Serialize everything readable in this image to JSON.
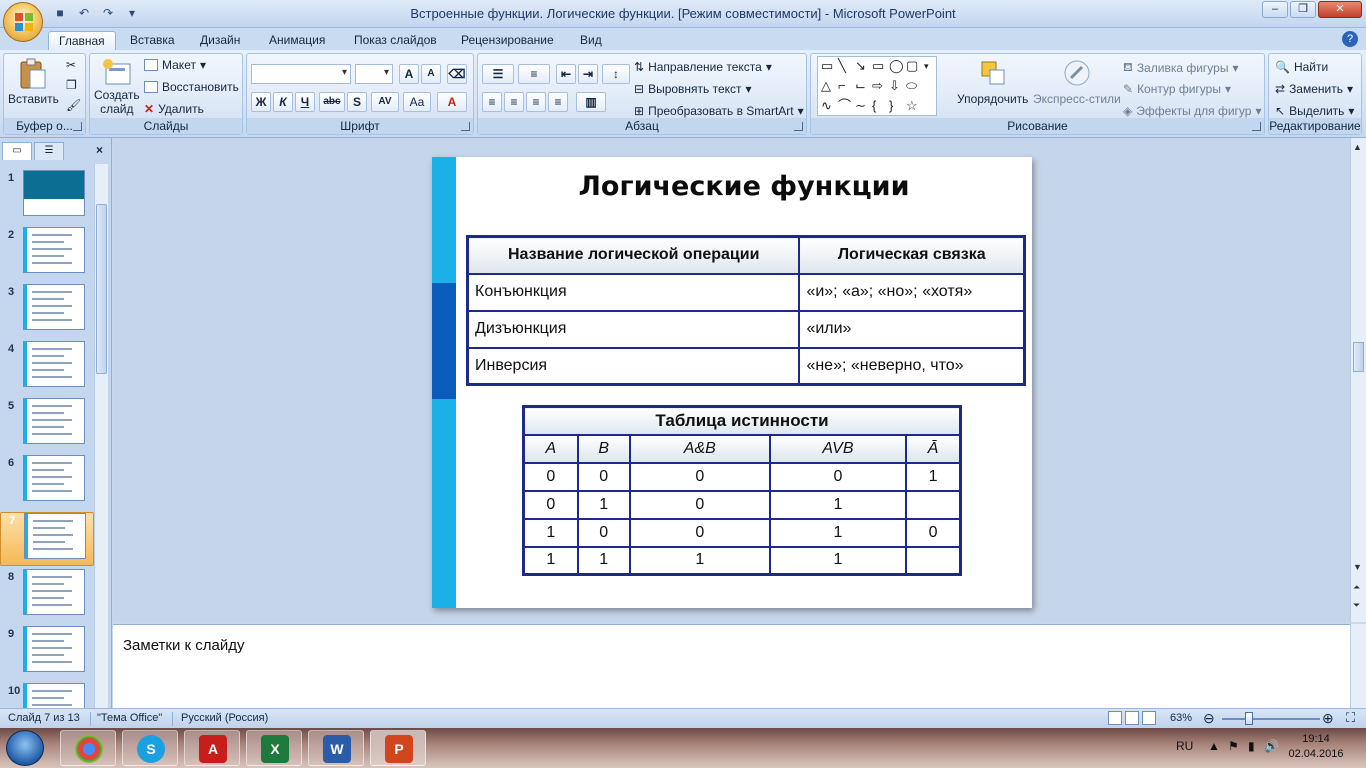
{
  "window": {
    "title": "Встроенные функции. Логические функции. [Режим совместимости] - Microsoft PowerPoint"
  },
  "ribbon_tabs": [
    "Главная",
    "Вставка",
    "Дизайн",
    "Анимация",
    "Показ слайдов",
    "Рецензирование",
    "Вид"
  ],
  "ribbon": {
    "clipboard": {
      "label": "Буфер о...",
      "paste": "Вставить"
    },
    "slides": {
      "label": "Слайды",
      "new_slide_line1": "Создать",
      "new_slide_line2": "слайд",
      "layout": "Макет",
      "reset": "Восстановить",
      "delete": "Удалить"
    },
    "font": {
      "label": "Шрифт",
      "bold": "Ж",
      "italic": "К",
      "underline": "Ч",
      "strike": "abc",
      "shadow": "S",
      "spacing": "AV",
      "case": "Aa",
      "color": "A",
      "grow": "A",
      "shrink": "A"
    },
    "paragraph": {
      "label": "Абзац",
      "text_direction": "Направление текста",
      "align_text": "Выровнять текст",
      "smartart": "Преобразовать в SmartArt"
    },
    "drawing": {
      "label": "Рисование",
      "arrange": "Упорядочить",
      "quick_styles": "Экспресс-стили",
      "fill": "Заливка фигуры",
      "outline": "Контур фигуры",
      "effects": "Эффекты для фигур"
    },
    "editing": {
      "label": "Редактирование",
      "find": "Найти",
      "replace": "Заменить",
      "select": "Выделить"
    }
  },
  "thumbnails": [
    "1",
    "2",
    "3",
    "4",
    "5",
    "6",
    "7",
    "8",
    "9",
    "10"
  ],
  "selected_slide": "7",
  "slide": {
    "title": "Логические функции",
    "ops_headers": [
      "Название логической операции",
      "Логическая связка"
    ],
    "ops_rows": [
      [
        "Конъюнкция",
        "«и»; «а»; «но»; «хотя»"
      ],
      [
        "Дизъюнкция",
        "«или»"
      ],
      [
        "Инверсия",
        "«не»; «неверно, что»"
      ]
    ],
    "truth_caption": "Таблица истинности",
    "truth_headers": [
      "A",
      "B",
      "A&B",
      "AVB",
      "Ā"
    ],
    "truth_rows": [
      [
        "0",
        "0",
        "0",
        "0",
        "1"
      ],
      [
        "0",
        "1",
        "0",
        "1",
        ""
      ],
      [
        "1",
        "0",
        "0",
        "1",
        "0"
      ],
      [
        "1",
        "1",
        "1",
        "1",
        ""
      ]
    ]
  },
  "notes": {
    "placeholder": "Заметки к слайду"
  },
  "status": {
    "slide_of": "Слайд 7 из 13",
    "theme": "\"Тема Office\"",
    "language": "Русский (Россия)",
    "zoom": "63%"
  },
  "taskbar": {
    "lang": "RU",
    "time": "19:14",
    "date": "02.04.2016"
  },
  "colors": {
    "accent_stripe_light": "#1bb0e6",
    "accent_stripe_dark": "#0b5bbd",
    "table_border": "#1d2a8c",
    "selection": "#f6b857"
  }
}
